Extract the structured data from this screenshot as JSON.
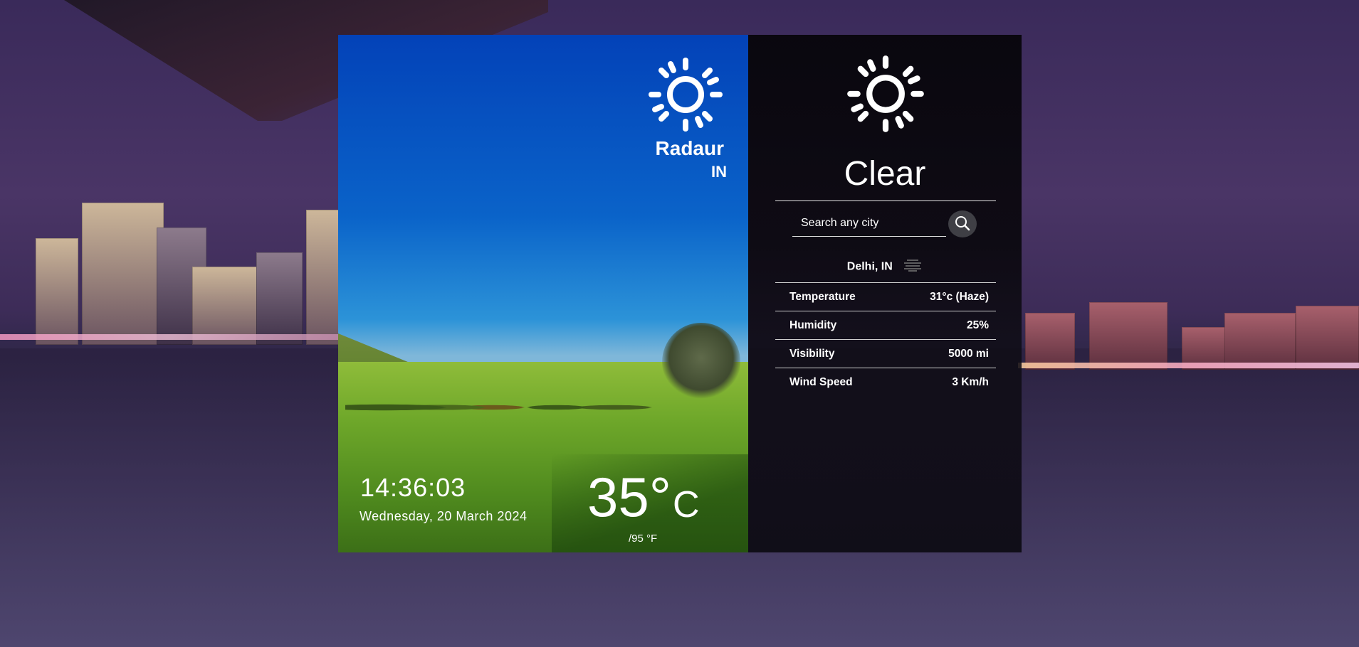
{
  "location_panel": {
    "city": "Radaur",
    "country": "IN",
    "icon": "sun-icon",
    "time": "14:36:03",
    "date": "Wednesday, 20 March 2024",
    "temperature_c": "35°",
    "unit": "C",
    "temperature_f": "/95 °F"
  },
  "detail_panel": {
    "icon": "sun-icon",
    "condition": "Clear",
    "search": {
      "placeholder": "Search any city",
      "value": ""
    },
    "search_icon": "search-icon",
    "result_location": "Delhi, IN",
    "result_icon": "haze-icon",
    "stats": [
      {
        "label": "Temperature",
        "value": "31°c (Haze)"
      },
      {
        "label": "Humidity",
        "value": "25%"
      },
      {
        "label": "Visibility",
        "value": "5000 mi"
      },
      {
        "label": "Wind Speed",
        "value": "3 Km/h"
      }
    ]
  }
}
